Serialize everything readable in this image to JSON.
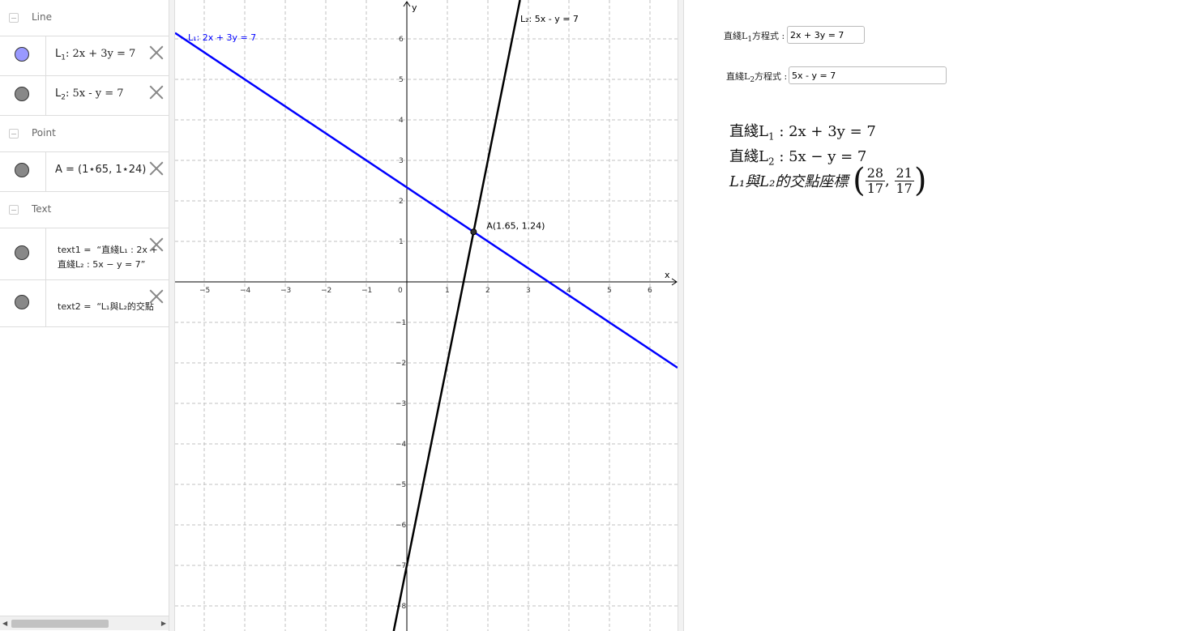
{
  "algebra": {
    "categories": {
      "line": "Line",
      "point": "Point",
      "text": "Text"
    },
    "items": {
      "l1": {
        "name": "L",
        "sub": "1",
        "expr": ": 2x + 3y = 7"
      },
      "l2": {
        "name": "L",
        "sub": "2",
        "expr": ": 5x - y = 7"
      },
      "a": {
        "expr": "A = (1⋆65, 1⋆24)"
      },
      "text1": {
        "label": "text1 =",
        "line1": "“直綫L₁ : 2x +",
        "line2": "直綫L₂ : 5x − y = 7”"
      },
      "text2": {
        "label": "text2 =",
        "line1": "“L₁與L₂的交點"
      }
    },
    "colors": {
      "l1": "#9999ff",
      "other": "#888888"
    }
  },
  "graph": {
    "x_ticks": [
      "−5",
      "−4",
      "−3",
      "−2",
      "−1",
      "1",
      "2",
      "3",
      "4",
      "5",
      "6"
    ],
    "y_ticks": [
      "6",
      "5",
      "4",
      "3",
      "2",
      "1",
      "−1",
      "−2",
      "−3",
      "−4",
      "−5",
      "−6",
      "−7",
      "−8"
    ],
    "origin_label": "0",
    "x_axis_label": "x",
    "y_axis_label": "y",
    "l1_label": "L₁: 2x + 3y = 7",
    "l2_label": "L₂: 5x - y = 7",
    "point_label": "A(1.65, 1.24)",
    "point": [
      1.647,
      1.235
    ],
    "l1_color": "#0000ff",
    "l2_color": "#000000"
  },
  "right": {
    "l1_input_label": "直綫L",
    "l1_input_sub": "1",
    "l1_input_suffix": "方程式 :",
    "l1_input_value": "2x + 3y = 7",
    "l2_input_label": "直綫L",
    "l2_input_sub": "2",
    "l2_input_suffix": "方程式 :",
    "l2_input_value": "5x - y = 7",
    "line1_prefix": "直綫L",
    "line1_sub": "1",
    "line1_expr": " : 2x + 3y = 7",
    "line2_prefix": "直綫L",
    "line2_sub": "2",
    "line2_expr": " : 5x − y = 7",
    "line3_text": "L₁與L₂的交點座標",
    "frac1_num": "28",
    "frac1_den": "17",
    "frac2_num": "21",
    "frac2_den": "17"
  }
}
